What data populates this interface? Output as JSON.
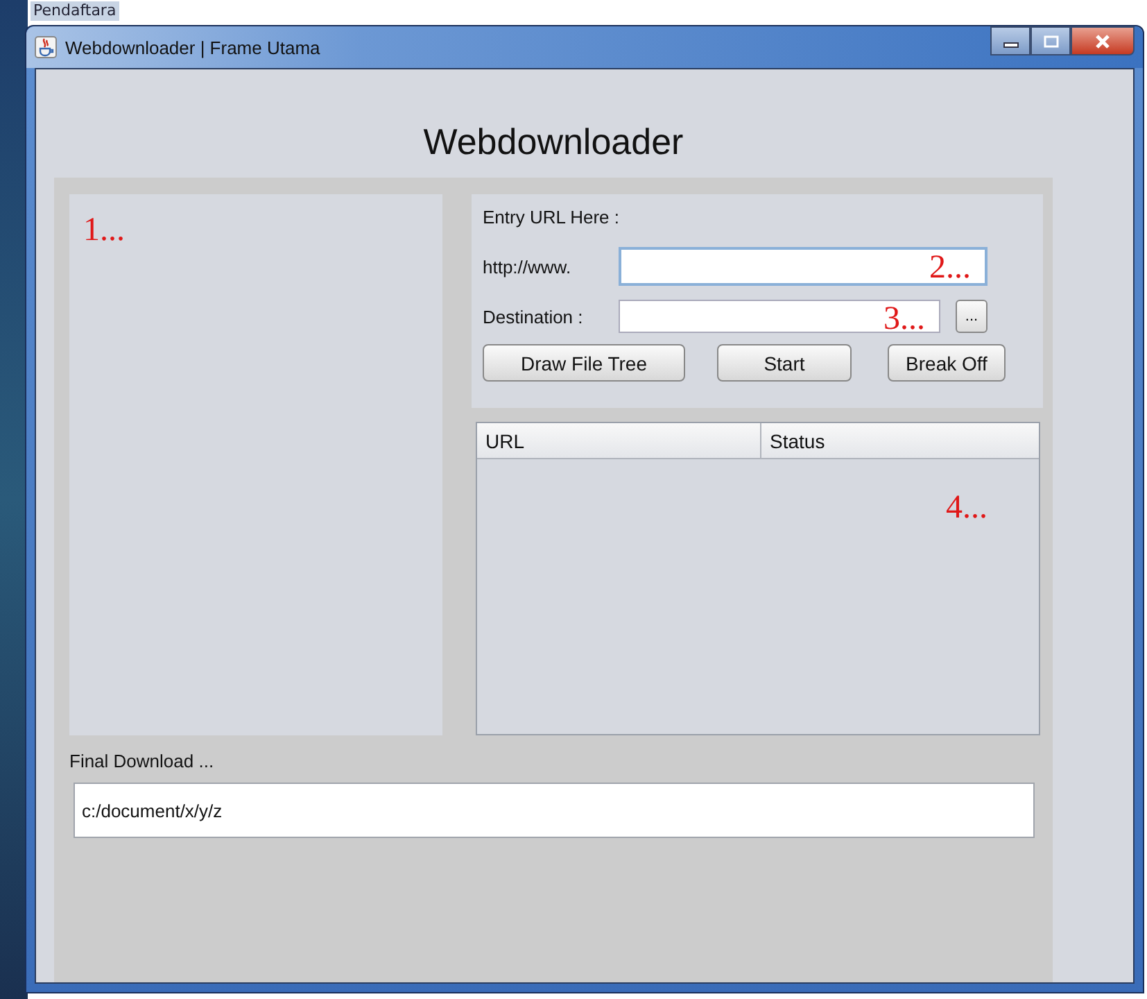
{
  "desktop": {
    "label": "Pendaftara"
  },
  "window": {
    "title": "Webdownloader | Frame Utama"
  },
  "heading": "Webdownloader",
  "left_panel": {
    "annotation": "1..."
  },
  "entry": {
    "label": "Entry URL Here :",
    "fields": [
      {
        "label": "http://www.",
        "focused": true,
        "annotation": "2..."
      },
      {
        "label": "Destination :",
        "focused": false,
        "annotation": "3...",
        "browse": "..."
      }
    ]
  },
  "buttons": [
    "Draw File Tree",
    "Start",
    "Break Off"
  ],
  "table": {
    "columns": [
      "URL",
      "Status"
    ],
    "annotation": "4..."
  },
  "final": {
    "label": "Final Download ...",
    "value": "c:/document/x/y/z"
  }
}
